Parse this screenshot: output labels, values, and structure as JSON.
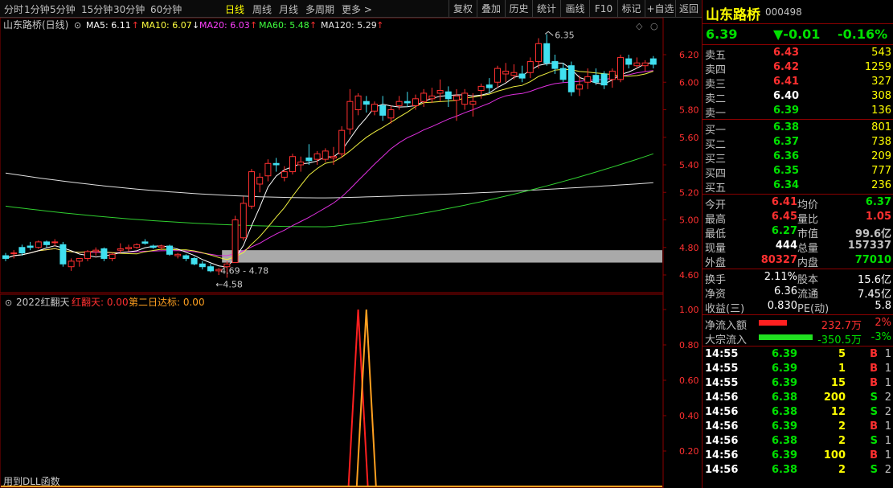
{
  "toolbar": {
    "periods": [
      "分时",
      "1分钟",
      "5分钟",
      "15分钟",
      "30分钟",
      "60分钟",
      "日线",
      "周线",
      "月线",
      "多周期",
      "更多 >"
    ],
    "active_period": "日线",
    "buttons": [
      "复权",
      "叠加",
      "历史",
      "统计",
      "画线",
      "F10",
      "标记",
      "+自选",
      "返回"
    ]
  },
  "main_chart": {
    "legend_title": "山东路桥(日线)",
    "ma": [
      {
        "label": "MA5: 6.11",
        "color": "#ffffff"
      },
      {
        "label": "MA10: 6.07",
        "color": "#ffff40"
      },
      {
        "label": "MA20: 6.03",
        "color": "#ff40ff"
      },
      {
        "label": "MA60: 5.48",
        "color": "#40ff40"
      },
      {
        "label": "MA120: 5.29",
        "color": "#e8e8e8"
      }
    ],
    "y_ticks": [
      "6.20",
      "6.00",
      "5.80",
      "5.60",
      "5.40",
      "5.20",
      "5.00",
      "4.80",
      "4.60"
    ],
    "high_label": "6.35",
    "low_label": "4.58",
    "range_label": "4.69 - 4.78"
  },
  "indicator": {
    "name": "2022红翻天",
    "line1": "红翻天: 0.00",
    "line2": "第二日达标: 0.00",
    "y_ticks": [
      "1.00",
      "0.80",
      "0.60",
      "0.40",
      "0.20"
    ],
    "footer": "用到DLL函数"
  },
  "quote": {
    "name": "山东路桥",
    "code": "000498",
    "price": "6.39",
    "change": "▼-0.01",
    "change_pct": "-0.16%",
    "asks": [
      {
        "label": "卖五",
        "price": "6.43",
        "vol": "543",
        "pc": "red"
      },
      {
        "label": "卖四",
        "price": "6.42",
        "vol": "1259",
        "pc": "red"
      },
      {
        "label": "卖三",
        "price": "6.41",
        "vol": "327",
        "pc": "red"
      },
      {
        "label": "卖二",
        "price": "6.40",
        "vol": "308",
        "pc": "white"
      },
      {
        "label": "卖一",
        "price": "6.39",
        "vol": "136",
        "pc": "green"
      }
    ],
    "bids": [
      {
        "label": "买一",
        "price": "6.38",
        "vol": "801",
        "pc": "green"
      },
      {
        "label": "买二",
        "price": "6.37",
        "vol": "738",
        "pc": "green"
      },
      {
        "label": "买三",
        "price": "6.36",
        "vol": "209",
        "pc": "green"
      },
      {
        "label": "买四",
        "price": "6.35",
        "vol": "777",
        "pc": "green"
      },
      {
        "label": "买五",
        "price": "6.34",
        "vol": "236",
        "pc": "green"
      }
    ],
    "stats": [
      {
        "l1": "今开",
        "v1": "6.41",
        "c1": "red",
        "l2": "均价",
        "v2": "6.37",
        "c2": "green"
      },
      {
        "l1": "最高",
        "v1": "6.45",
        "c1": "red",
        "l2": "量比",
        "v2": "1.05",
        "c2": "red"
      },
      {
        "l1": "最低",
        "v1": "6.27",
        "c1": "green",
        "l2": "市值",
        "v2": "99.6亿",
        "c2": "gray"
      },
      {
        "l1": "现量",
        "v1": "444",
        "c1": "white",
        "l2": "总量",
        "v2": "157337",
        "c2": "gray"
      },
      {
        "l1": "外盘",
        "v1": "80327",
        "c1": "red",
        "l2": "内盘",
        "v2": "77010",
        "c2": "green"
      }
    ],
    "fin": [
      {
        "l1": "换手",
        "v1": "2.11%",
        "l2": "股本",
        "v2": "15.6亿"
      },
      {
        "l1": "净资",
        "v1": "6.36",
        "l2": "流通",
        "v2": "7.45亿"
      },
      {
        "l1": "收益(三)",
        "v1": "0.830",
        "l2": "PE(动)",
        "v2": "5.8"
      }
    ],
    "flow": [
      {
        "label": "净流入额",
        "bar_color": "#ff2020",
        "bar_fraction": 0.5,
        "value": "232.7万",
        "pct": "2%",
        "vc": "red"
      },
      {
        "label": "大宗流入",
        "bar_color": "#20e020",
        "bar_fraction": 0.95,
        "value": "-350.5万",
        "pct": "-3%",
        "vc": "green"
      }
    ],
    "ticks": [
      {
        "t": "14:55",
        "p": "6.39",
        "v": "5",
        "s": "B",
        "n": "1"
      },
      {
        "t": "14:55",
        "p": "6.39",
        "v": "1",
        "s": "B",
        "n": "1"
      },
      {
        "t": "14:55",
        "p": "6.39",
        "v": "15",
        "s": "B",
        "n": "1"
      },
      {
        "t": "14:56",
        "p": "6.38",
        "v": "200",
        "s": "S",
        "n": "2"
      },
      {
        "t": "14:56",
        "p": "6.38",
        "v": "12",
        "s": "S",
        "n": "2"
      },
      {
        "t": "14:56",
        "p": "6.39",
        "v": "2",
        "s": "B",
        "n": "1"
      },
      {
        "t": "14:56",
        "p": "6.38",
        "v": "2",
        "s": "S",
        "n": "1"
      },
      {
        "t": "14:56",
        "p": "6.39",
        "v": "100",
        "s": "B",
        "n": "1"
      },
      {
        "t": "14:56",
        "p": "6.38",
        "v": "2",
        "s": "S",
        "n": "2"
      }
    ]
  },
  "chart_data": {
    "type": "candlestick",
    "candles": [
      [
        4.74,
        4.76,
        4.7,
        4.72
      ],
      [
        4.76,
        4.78,
        4.72,
        4.76
      ],
      [
        4.8,
        4.82,
        4.74,
        4.76
      ],
      [
        4.81,
        4.84,
        4.78,
        4.8
      ],
      [
        4.8,
        4.85,
        4.79,
        4.84
      ],
      [
        4.84,
        4.85,
        4.8,
        4.82
      ],
      [
        4.84,
        4.86,
        4.81,
        4.84
      ],
      [
        4.82,
        4.84,
        4.66,
        4.68
      ],
      [
        4.66,
        4.72,
        4.63,
        4.7
      ],
      [
        4.7,
        4.72,
        4.66,
        4.72
      ],
      [
        4.72,
        4.78,
        4.7,
        4.77
      ],
      [
        4.77,
        4.8,
        4.74,
        4.78
      ],
      [
        4.79,
        4.8,
        4.7,
        4.72
      ],
      [
        4.72,
        4.76,
        4.7,
        4.75
      ],
      [
        4.78,
        4.83,
        4.76,
        4.79
      ],
      [
        4.79,
        4.82,
        4.77,
        4.8
      ],
      [
        4.8,
        4.83,
        4.79,
        4.82
      ],
      [
        4.84,
        4.86,
        4.82,
        4.83
      ],
      [
        4.81,
        4.82,
        4.79,
        4.8
      ],
      [
        4.8,
        4.82,
        4.78,
        4.81
      ],
      [
        4.81,
        4.82,
        4.74,
        4.75
      ],
      [
        4.74,
        4.76,
        4.72,
        4.75
      ],
      [
        4.74,
        4.75,
        4.7,
        4.72
      ],
      [
        4.72,
        4.73,
        4.67,
        4.68
      ],
      [
        4.68,
        4.7,
        4.64,
        4.66
      ],
      [
        4.66,
        4.68,
        4.62,
        4.63
      ],
      [
        4.63,
        4.65,
        4.6,
        4.64
      ],
      [
        4.66,
        4.7,
        4.58,
        4.68
      ],
      [
        4.69,
        5.03,
        4.69,
        5.0
      ],
      [
        4.87,
        5.17,
        4.85,
        5.12
      ],
      [
        5.1,
        5.37,
        5.08,
        5.35
      ],
      [
        5.26,
        5.34,
        5.2,
        5.31
      ],
      [
        5.32,
        5.44,
        5.28,
        5.41
      ],
      [
        5.41,
        5.45,
        5.35,
        5.4
      ],
      [
        5.31,
        5.39,
        5.28,
        5.35
      ],
      [
        5.35,
        5.48,
        5.33,
        5.46
      ],
      [
        5.4,
        5.46,
        5.35,
        5.42
      ],
      [
        5.45,
        5.55,
        5.4,
        5.43
      ],
      [
        5.44,
        5.5,
        5.4,
        5.48
      ],
      [
        5.44,
        5.52,
        5.42,
        5.5
      ],
      [
        5.45,
        5.53,
        5.4,
        5.46
      ],
      [
        5.48,
        5.68,
        5.45,
        5.65
      ],
      [
        5.66,
        5.95,
        5.62,
        5.86
      ],
      [
        5.8,
        5.92,
        5.76,
        5.9
      ],
      [
        5.86,
        5.9,
        5.78,
        5.84
      ],
      [
        5.79,
        5.86,
        5.76,
        5.84
      ],
      [
        5.83,
        5.9,
        5.72,
        5.76
      ],
      [
        5.74,
        5.83,
        5.7,
        5.8
      ],
      [
        5.83,
        5.9,
        5.8,
        5.86
      ],
      [
        5.86,
        5.93,
        5.82,
        5.85
      ],
      [
        5.83,
        5.91,
        5.8,
        5.88
      ],
      [
        5.86,
        5.95,
        5.82,
        5.92
      ],
      [
        5.88,
        5.96,
        5.85,
        5.9
      ],
      [
        5.92,
        6.02,
        5.86,
        5.94
      ],
      [
        5.93,
        5.97,
        5.82,
        5.88
      ],
      [
        5.87,
        5.95,
        5.72,
        5.9
      ],
      [
        5.84,
        5.95,
        5.8,
        5.92
      ],
      [
        5.84,
        5.92,
        5.75,
        5.86
      ],
      [
        5.94,
        5.99,
        5.88,
        5.97
      ],
      [
        5.98,
        6.03,
        5.92,
        5.96
      ],
      [
        6.0,
        6.12,
        5.96,
        6.1
      ],
      [
        6.06,
        6.14,
        6.0,
        6.08
      ],
      [
        6.05,
        6.13,
        6.02,
        6.07
      ],
      [
        6.06,
        6.12,
        6.0,
        6.03
      ],
      [
        6.07,
        6.18,
        6.03,
        6.15
      ],
      [
        6.15,
        6.32,
        6.1,
        6.28
      ],
      [
        6.28,
        6.35,
        6.12,
        6.14
      ],
      [
        6.15,
        6.2,
        6.06,
        6.1
      ],
      [
        6.1,
        6.14,
        6.0,
        6.02
      ],
      [
        6.12,
        6.15,
        5.9,
        5.93
      ],
      [
        5.95,
        6.05,
        5.9,
        5.98
      ],
      [
        6.0,
        6.1,
        5.95,
        6.04
      ],
      [
        6.05,
        6.1,
        5.98,
        6.0
      ],
      [
        6.06,
        6.08,
        5.95,
        5.98
      ],
      [
        6.02,
        6.1,
        5.96,
        6.08
      ],
      [
        6.02,
        6.2,
        6.0,
        6.18
      ],
      [
        6.17,
        6.2,
        6.1,
        6.13
      ],
      [
        6.12,
        6.18,
        6.1,
        6.14
      ],
      [
        6.12,
        6.16,
        6.08,
        6.14
      ],
      [
        6.17,
        6.19,
        6.1,
        6.13
      ]
    ],
    "ma120": [
      5.34,
      5.16,
      5.27
    ],
    "ma60": [
      5.1,
      4.95,
      5.48
    ],
    "highlight_band": [
      4.69,
      4.78
    ],
    "indicator_spikes": [
      {
        "index": 43,
        "color": "#ff2020"
      },
      {
        "index": 44,
        "color": "#ffa020"
      }
    ],
    "y_range": [
      4.5,
      6.4
    ]
  }
}
